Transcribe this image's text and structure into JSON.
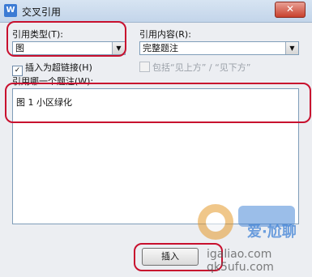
{
  "window": {
    "title": "交叉引用",
    "close_glyph": "✕",
    "icon": "W"
  },
  "reference_type": {
    "label": "引用类型(T):",
    "value": "图"
  },
  "reference_content": {
    "label": "引用内容(R):",
    "value": "完整题注"
  },
  "insert_hyperlink": {
    "label": "插入为超链接(H)",
    "checked": true
  },
  "include_above_below": {
    "label": "包括“见上方” / “见下方”",
    "checked": false
  },
  "which_caption": {
    "label": "引用哪一个题注(W):",
    "items": [
      "图 1 小区绿化"
    ]
  },
  "footer": {
    "insert_button": "插入"
  },
  "watermark": {
    "line1": "爱·尬聊",
    "line2": "igaliao.com",
    "line3": "qk5ufu.com"
  },
  "colors": {
    "highlight_red": "#c8102e",
    "accent": "#3b7bd4"
  }
}
